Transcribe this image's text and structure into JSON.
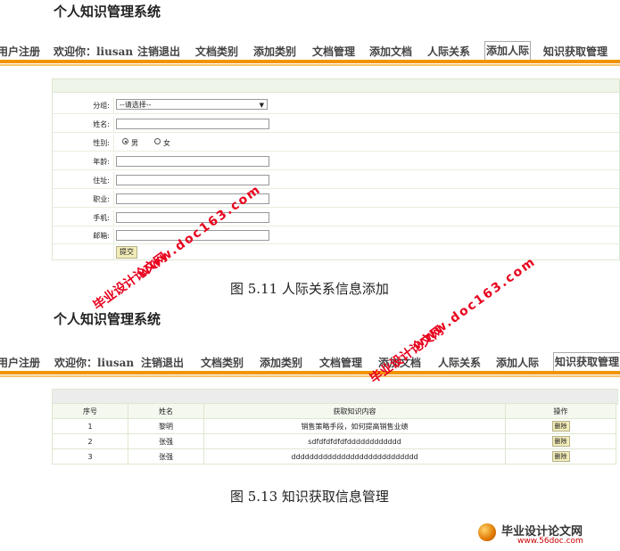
{
  "fig1": {
    "system_title": "个人知识管理系统",
    "nav": [
      "用户注册",
      "欢迎你：liusan",
      "注销退出",
      "文档类别",
      "添加类别",
      "文档管理",
      "添加文档",
      "人际关系",
      "添加人际",
      "知识获取管理"
    ],
    "selected_nav": "添加人际",
    "form": {
      "group_label": "分组:",
      "group_value": "--请选择--",
      "name_label": "姓名:",
      "gender_label": "性别:",
      "gender_male": "男",
      "gender_female": "女",
      "age_label": "年龄:",
      "address_label": "住址:",
      "job_label": "职业:",
      "phone_label": "手机:",
      "email_label": "邮箱:",
      "submit_label": "提交"
    },
    "caption": "图 5.11  人际关系信息添加"
  },
  "fig2": {
    "system_title": "个人知识管理系统",
    "nav": [
      "用户注册",
      "欢迎你：liusan",
      "注销退出",
      "文档类别",
      "添加类别",
      "文档管理",
      "添加文档",
      "人际关系",
      "添加人际",
      "知识获取管理"
    ],
    "selected_nav": "知识获取管理",
    "table": {
      "headers": [
        "序号",
        "姓名",
        "获取知识内容",
        "操作"
      ],
      "rows": [
        [
          "1",
          "黎明",
          "销售策略手段，如何提高销售业绩",
          "删除"
        ],
        [
          "2",
          "张强",
          "sdfdfdfdfdfdddddddddddd",
          "删除"
        ],
        [
          "3",
          "张强",
          "dddddddddddddddddddddddddddd",
          "删除"
        ]
      ]
    },
    "caption": "图 5.13  知识获取信息管理"
  },
  "watermarks": {
    "brand": "毕业设计论文网",
    "url": "www.doc163.com",
    "logo_main": "毕业设计论文网",
    "logo_sub": "www.56doc.com"
  }
}
